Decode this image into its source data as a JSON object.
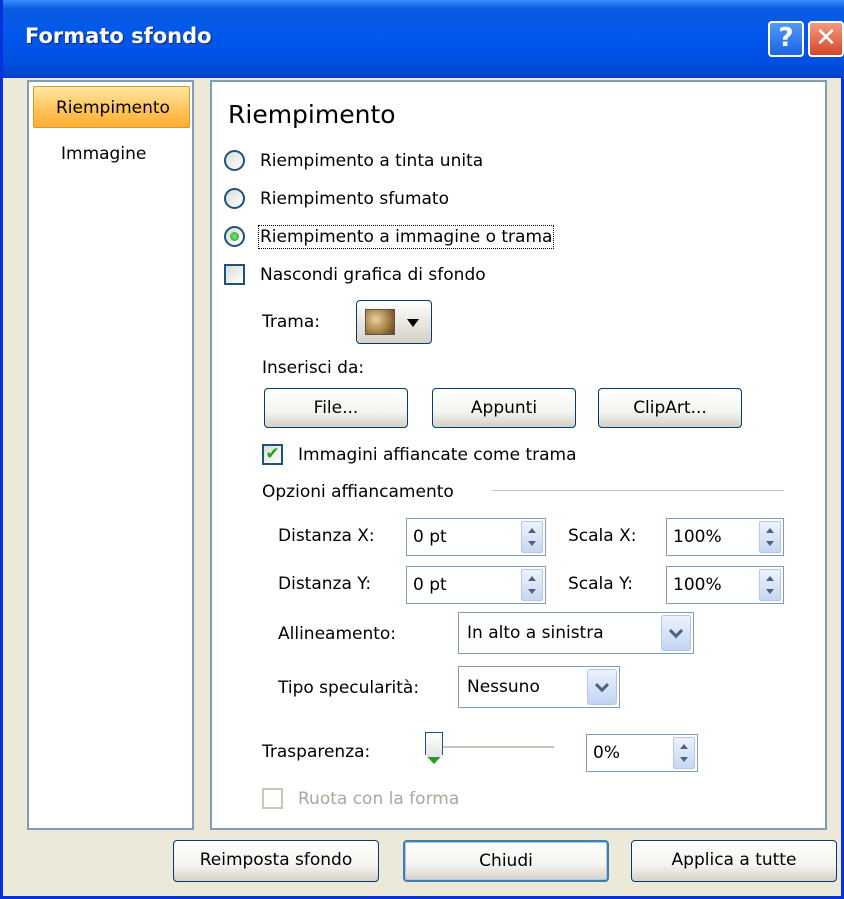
{
  "window": {
    "title": "Formato sfondo"
  },
  "titlebar": {
    "help_glyph": "?",
    "close_glyph": "✕"
  },
  "nav": {
    "items": [
      {
        "label": "Riempimento",
        "selected": true
      },
      {
        "label": "Immagine",
        "selected": false
      }
    ]
  },
  "panel": {
    "heading": "Riempimento",
    "fill_options": [
      {
        "label": "Riempimento a tinta unita",
        "checked": false
      },
      {
        "label": "Riempimento sfumato",
        "checked": false
      },
      {
        "label": "Riempimento a immagine o trama",
        "checked": true
      }
    ],
    "hide_graphics": {
      "label": "Nascondi grafica di sfondo",
      "checked": false
    },
    "texture": {
      "label": "Trama:",
      "value_icon": "texture-swatch-icon"
    },
    "insert_from": {
      "label": "Inserisci da:",
      "buttons": {
        "file": "File...",
        "clipboard": "Appunti",
        "clipart": "ClipArt..."
      }
    },
    "tile": {
      "label": "Immagini affiancate come trama",
      "checked": true
    },
    "tiling_options": {
      "label": "Opzioni affiancamento",
      "offset_x": {
        "label": "Distanza X:",
        "value": "0 pt"
      },
      "offset_y": {
        "label": "Distanza Y:",
        "value": "0 pt"
      },
      "scale_x": {
        "label": "Scala X:",
        "value": "100%"
      },
      "scale_y": {
        "label": "Scala Y:",
        "value": "100%"
      },
      "alignment": {
        "label": "Allineamento:",
        "value": "In alto a sinistra"
      },
      "mirror": {
        "label": "Tipo specularità:",
        "value": "Nessuno"
      }
    },
    "transparency": {
      "label": "Trasparenza:",
      "value": "0%",
      "level": 0
    },
    "rotate_with_shape": {
      "label": "Ruota con la forma",
      "checked": false,
      "enabled": false
    }
  },
  "footer": {
    "reset": "Reimposta sfondo",
    "close": "Chiudi",
    "apply_all": "Applica a tutte"
  },
  "colors": {
    "titlebar": "#0058ee",
    "dialog_bg": "#ece9d8",
    "selected_nav": "#ffc45c",
    "check_green": "#21a121"
  }
}
